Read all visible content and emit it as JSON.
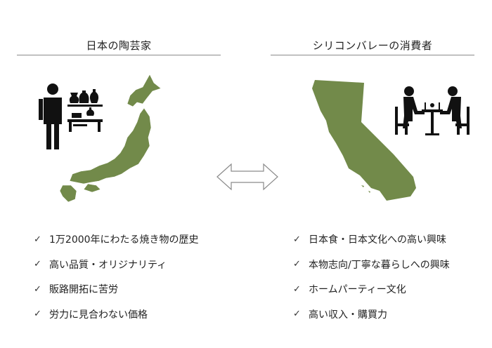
{
  "left": {
    "heading": "日本の陶芸家",
    "items": [
      "1万2000年にわたる焼き物の歴史",
      "高い品質・オリジナリティ",
      "販路開拓に苦労",
      "労力に見合わない価格"
    ]
  },
  "right": {
    "heading": "シリコンバレーの消費者",
    "items": [
      "日本食・日本文化への高い興味",
      "本物志向/丁寧な暮らしへの興味",
      "ホームパーティー文化",
      "高い収入・購買力"
    ]
  },
  "colors": {
    "map_green": "#728a4a",
    "icon_black": "#111111",
    "rule_gray": "#8a8a8a"
  },
  "icons": {
    "check": "✓"
  }
}
